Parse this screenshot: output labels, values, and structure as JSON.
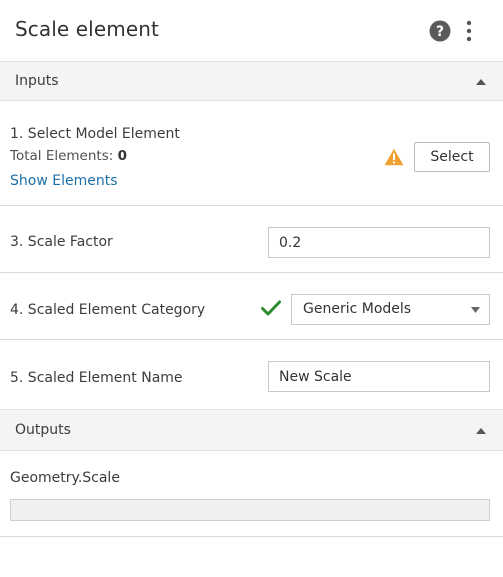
{
  "header": {
    "title": "Scale element",
    "help_icon": "help-icon",
    "more_icon": "more-vertical-icon"
  },
  "inputs_section": {
    "title": "Inputs",
    "toggle_icon": "chevron-up-icon"
  },
  "select_model": {
    "label": "1. Select Model Element",
    "total_label": "Total Elements: ",
    "total_value": "0",
    "link": "Show Elements",
    "button": "Select",
    "status_icon": "warning-icon",
    "status_color": "#f0a030"
  },
  "scale_factor": {
    "label": "3. Scale Factor",
    "value": "0.2"
  },
  "category": {
    "label": "4. Scaled Element Category",
    "value": "Generic Models",
    "status_icon": "check-icon",
    "status_color": "#2e8b2e"
  },
  "element_name": {
    "label": "5. Scaled Element Name",
    "value": "New Scale"
  },
  "outputs_section": {
    "title": "Outputs",
    "toggle_icon": "chevron-up-icon"
  },
  "geometry": {
    "label": "Geometry.Scale",
    "value": ""
  }
}
